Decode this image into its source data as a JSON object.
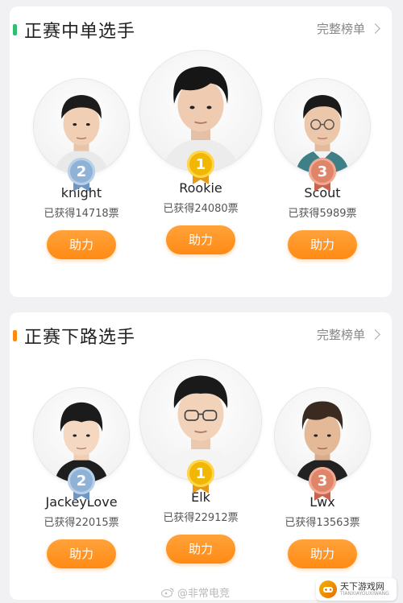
{
  "sections": [
    {
      "title": "正赛中单选手",
      "more_label": "完整榜单",
      "accent": "#2fbf71",
      "players": [
        {
          "name": "knight",
          "votes": "已获得14718票",
          "rank": "2",
          "button": "助力"
        },
        {
          "name": "Rookie",
          "votes": "已获得24080票",
          "rank": "1",
          "button": "助力"
        },
        {
          "name": "Scout",
          "votes": "已获得5989票",
          "rank": "3",
          "button": "助力"
        }
      ]
    },
    {
      "title": "正赛下路选手",
      "more_label": "完整榜单",
      "accent": "#ff8a14",
      "players": [
        {
          "name": "JackeyLove",
          "votes": "已获得22015票",
          "rank": "2",
          "button": "助力"
        },
        {
          "name": "Elk",
          "votes": "已获得22912票",
          "rank": "1",
          "button": "助力"
        },
        {
          "name": "Lwx",
          "votes": "已获得13563票",
          "rank": "3",
          "button": "助力"
        }
      ]
    }
  ],
  "medal_colors": {
    "1": "#f2b705",
    "2": "#8fb3d6",
    "3": "#e0846a"
  },
  "watermark": "@非常电竞",
  "site_logo": {
    "name": "天下游戏网",
    "sub": "TIANXIAYOUXIWANG"
  }
}
